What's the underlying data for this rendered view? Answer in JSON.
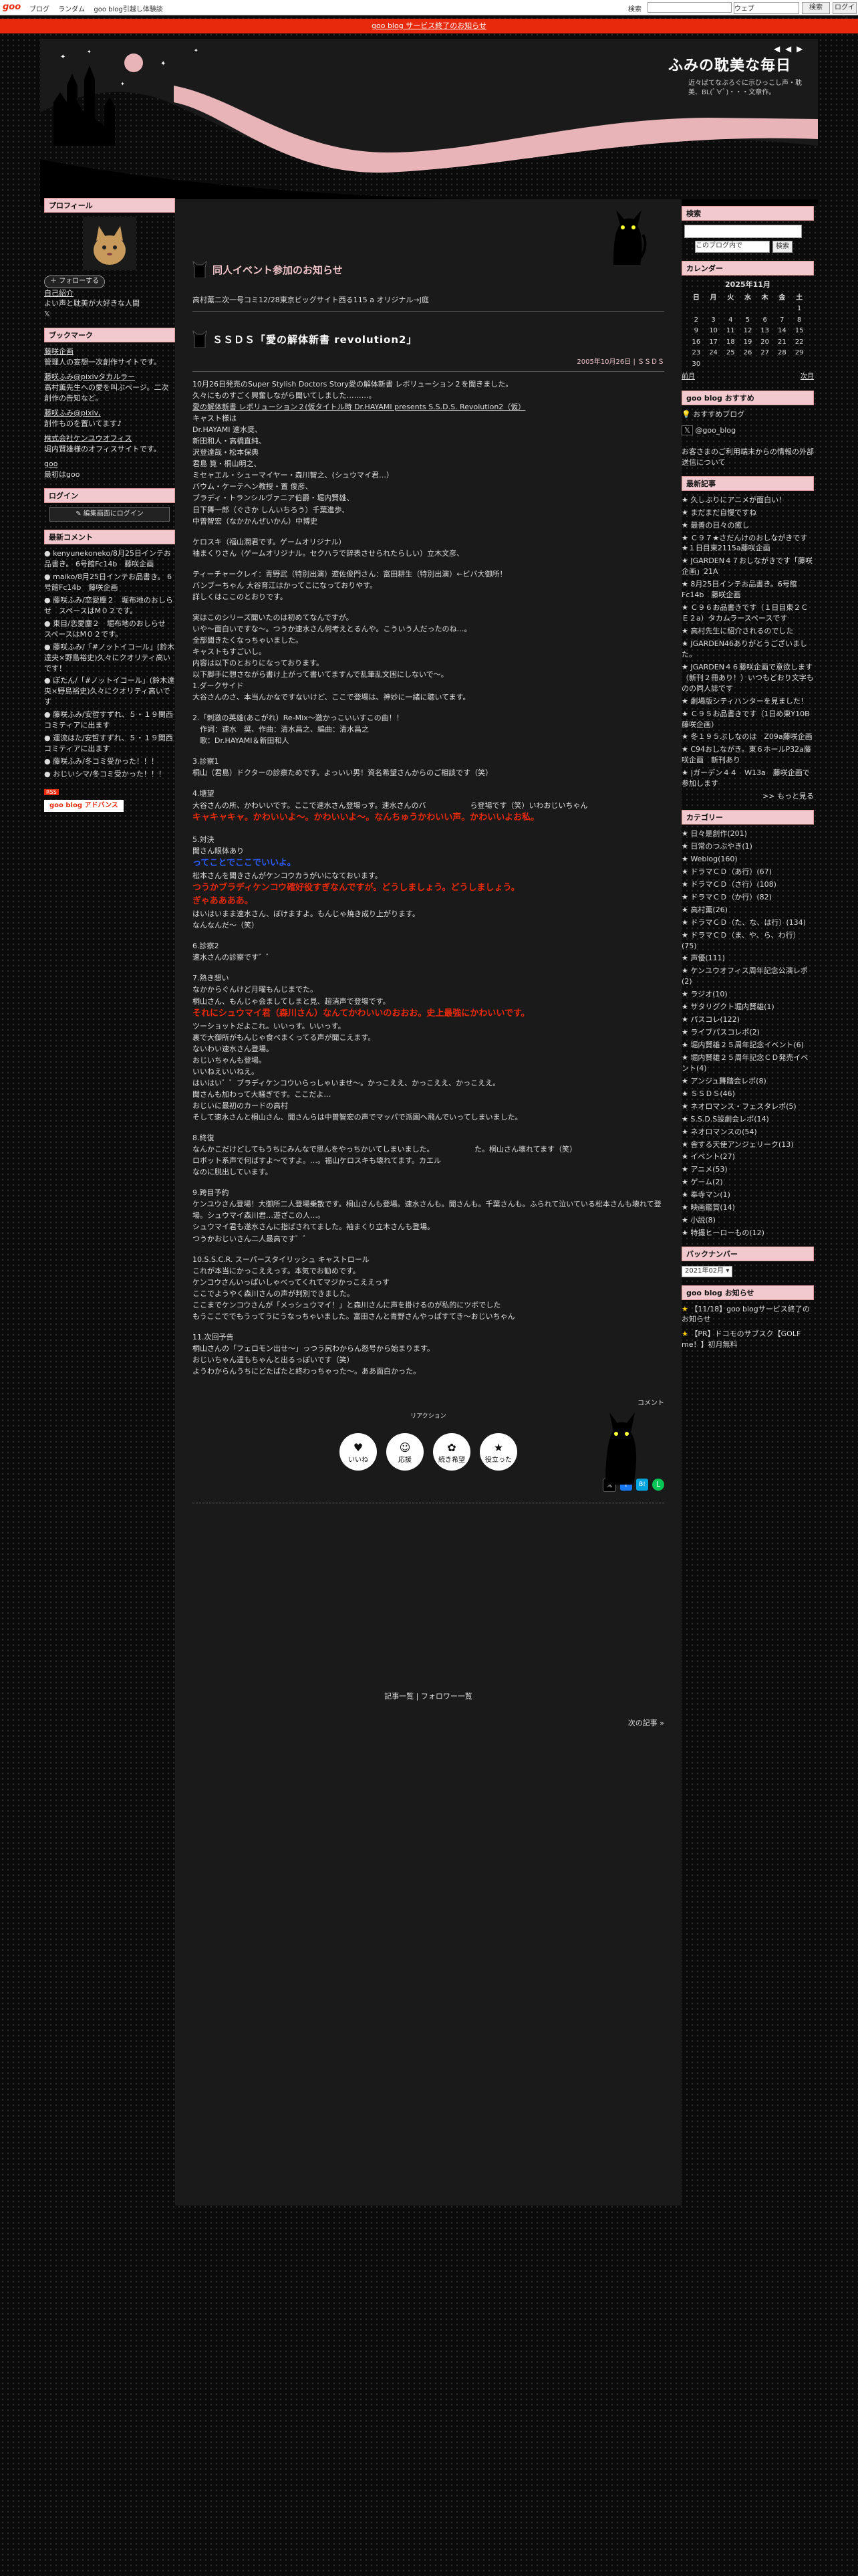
{
  "topbar": {
    "logo": "goo",
    "nav": [
      "ブログ",
      "ランダム",
      "goo blog引越し体験談"
    ],
    "search_label": "検索",
    "search_select": "ウェブ",
    "search_button": "検索",
    "search_button2": "ログイン"
  },
  "notice": {
    "text": "goo blog サービス終了のお知らせ"
  },
  "header": {
    "title": "ふみの耽美な毎日",
    "description": "近々ぱてなぶろぐに示ひっこし声・耽美、BL(ﾟ∀ﾟ)・・・文章作。",
    "nav_icons": "◀ ◀ ▶"
  },
  "left": {
    "profile_title": "プロフィール",
    "follow_button": "フォローする",
    "profile_links": [
      "自己紹介",
      "よい声と耽美が大好きな人間",
      "𝕏"
    ],
    "bookmark_title": "ブックマーク",
    "bookmarks": [
      "藤咲企画",
      "管理人の妄想一次創作サイトです。",
      "藤咲ふみ@pixivタカルラー",
      "高村薫先生への愛を叫ぶページ。二次創作の告知など。",
      "藤咲ふみ@pixiv,",
      "創作ものを置いてます♪",
      "株式会社ケンユウオフィス",
      "堀内賢雄様のオフィスサイトです。",
      "goo",
      "最初はgoo"
    ],
    "login_title": "ログイン",
    "login_button": "編集画面にログイン",
    "comments_title": "最新コメント",
    "comments": [
      "kenyunekoneko/8月25日インテお品書き。 6号館Fc14b　藤咲企画",
      "maiko/8月25日インテお品書き。 6号館Fc14b　藤咲企画",
      "藤咲ふみ/恋愛塵２　堀布地のおしらせ　スペースはM０２です。",
      "東目/恋愛塵２　堀布地のおしらせ　スペースはM０２です。",
      "藤咲ふみ/「#ノットイコール」(鈴木達央×野島裕史)久々にクオリティ高いです！",
      "ぽたん/「#ノットイコール」(鈴木達央×野島裕史)久々にクオリティ高いです",
      "藤咲ふみ/安哲すずれ、５・１９関西コミティアに出ます",
      "運流はた/安哲すずれ、５・１９関西コミティアに出ます",
      "藤咲ふみ/冬コミ受かった！！！",
      "おじいシマ/冬コミ受かった！！！"
    ],
    "rss": "RSS",
    "adv_button": "goo blog アドバンス"
  },
  "right": {
    "search_title": "検索",
    "search_select": "このブログ内で",
    "search_button": "検索",
    "calendar_title": "カレンダー",
    "calendar_month": "2025年11月",
    "weekdays": [
      "日",
      "月",
      "火",
      "水",
      "木",
      "金",
      "土"
    ],
    "weeks": [
      [
        "",
        "",
        "",
        "",
        "",
        "",
        "1"
      ],
      [
        "2",
        "3",
        "4",
        "5",
        "6",
        "7",
        "8"
      ],
      [
        "9",
        "10",
        "11",
        "12",
        "13",
        "14",
        "15"
      ],
      [
        "16",
        "17",
        "18",
        "19",
        "20",
        "21",
        "22"
      ],
      [
        "23",
        "24",
        "25",
        "26",
        "27",
        "28",
        "29"
      ],
      [
        "30",
        "",
        "",
        "",
        "",
        "",
        ""
      ]
    ],
    "cal_prev": "前月",
    "cal_next": "次月",
    "follow_title": "goo blog おすすめ",
    "follow_items": [
      "おすすめブログ",
      "@goo_blog"
    ],
    "follow_note": "お客さまのご利用端末からの情報の外部送信について",
    "recent_title": "最新記事",
    "recent": [
      "久しぶりにアニメが面白い！",
      "まだまだ自慢ですね",
      "最善の日々の癒し",
      "Ｃ９７★さだんけのおしながきです★１日目東2115a藤咲企画",
      "JGARDEN４７おしながきです「藤咲企画」21A",
      "8月25日インテお品書き。6号館Fc14b　藤咲企画",
      "Ｃ９６お品書きです（１日目東２ＣＥ２a）タカムラースペースです",
      "高村先生に紹介されるのでした",
      "JGARDEN46ありがとうございました。",
      "JGARDEN４６藤咲企画で意欲します（新刊２冊あり！）いつもどおり文字ものの同人誌です",
      "劇場版シティハンターを見ました！",
      "Ｃ９５お品書きです（1日め東Y10B藤咲企画）",
      "冬１９５ぶしなのは　Z09a藤咲企画",
      "C94おしながき。東６ホールP32a藤咲企画　新刊あり",
      "|ガーデン４４　Ｗ13a　藤咲企画で参加します"
    ],
    "recent_more": ">> もっと見る",
    "category_title": "カテゴリー",
    "categories": [
      "日々是創作(201)",
      "日常のつぶやき(1)",
      "Weblog(160)",
      "ドラマＣＤ（あ行）(67)",
      "ドラマＣＤ（さ行）(108)",
      "ドラマＣＤ（か行）(82)",
      "高村薫(26)",
      "ドラマＣＤ（た、な、は行）(134)",
      "ドラマＣＤ（ま、や、ら、わ行）(75)",
      "声優(111)",
      "ケンユウオフィス周年記念公演レポ(2)",
      "ラジオ(10)",
      "サタリグクト堀内賢雄(1)",
      "パスコレ(122)",
      "ライブパスコレポ(2)",
      "堀内賢雄２５周年記念イベント(6)",
      "堀内賢雄２５周年記念ＣＤ発売イベント(4)",
      "アンジュ舞踏会レポ(8)",
      "ＳＳＤＳ(46)",
      "ネオロマンス・フェスタレポ(5)",
      "S.S.D.S設劇会レポ(14)",
      "ネオロマンスの(54)",
      "舎する天使アンジェリーク(13)",
      "イベント(27)",
      "アニメ(53)",
      "ゲーム(2)",
      "奉寺マン(1)",
      "映画鑑賞(14)",
      "小説(8)",
      "特撮ヒーローもの(12)"
    ],
    "backnumber_title": "バックナンバー",
    "backnumber_select": "2021年02月",
    "news_title": "goo blog お知らせ",
    "news": [
      "【11/18】goo blogサービス終了のお知らせ",
      "【PR】ドコモのサブスク【GOLF me！】初月無料"
    ]
  },
  "post1": {
    "title": "同人イベント参加のお知らせ",
    "text": "高村薫二次一号コミ12/28東京ビッグサイト西る115 a オリジナル→J庭"
  },
  "post2": {
    "title": "ＳＳＤＳ「愛の解体新書 revolution2」",
    "date": "2005年10月26日 | ＳＳＤＳ",
    "paragraphs": [
      "10月26日発売のSuper Stylish Doctors Story愛の解体新書 レボリューション２を聞きました。",
      "久々にものすごく興奮しながら聞いてしました………。",
      "愛の解体新書 レボリューション２(仮タイトル時 Dr.HAYAMI presents S.S.D.S. Revolution2（仮）",
      "キャスト様は",
      "Dr.HAYAMI 速水奨、",
      "新田和人・高橋直純、",
      "沢登達哉・松本保典",
      "君島 筧・桐山明之、",
      "ミセャエル・シューマイヤー・森川智之、(シュウマイ君…）",
      "バウム・ケーテヘン教授・置 俊彦、",
      "ブラディ・トランシルヴァニア伯爵・堀内賢雄、",
      "日下舞一郎（ぐさか しんいちろう）千葉進歩、",
      "中曽智宏（なかかんぜいかん）中博史",
      "ケロスキ（福山潤君です。ゲームオリジナル）",
      "袖まくりさん（ゲームオリジナル。セクハラで辞表させられたらしい）立木文彦、",
      "ティーチャークレイ：青野武（特別出演）遊佐俊門さん：富田耕生（特別出演）←ビバ大御所！",
      "バンブーちゃん 大谷育江はかってこになっておりやす。",
      "詳しくはここのとおりです。",
      "実はこのシリーズ聞いたのは初めてなんですが。",
      "いや〜面白いですな〜。つうか速水さん何考えとるんや。こういう人だったのね…。",
      "全部聞きたくなっちゃいました。",
      "キャストもすごいし。",
      "内容は以下のとおりになっております。",
      "以下脚手に想さながら書け上がって書いてますんで乱筆乱文困にしないで〜。",
      "1.ダークサイド",
      "大谷さんのさ、本当んかなですないけど、ここで登場は、神妙に一緒に聴いてます。",
      "2.「刺激の英雄(あこがれ）Re-Mix〜激かっこいいすこの曲！！",
      "　作詞：速水　奨、作曲：清水昌之、編曲：清水昌之",
      "　歌：Dr.HAYAMI＆新田和人",
      "3.診察1",
      "桐山（君島）ドクターの診察ためです。よっいい男！資名希望さんからのご相談です（笑）",
      "4.塘望",
      "大谷さんの所、かわいいです。ここで速水さん登場っす。速水さんのバ　　　　　　ら登場です（笑）いわおじいちゃん",
      "キャキャキャ。かわいいよ〜。かわいいよ〜。なんちゅうかわいい声。かわいいよお私。",
      "5.対決",
      "聞さん眼体あり",
      "ってことでここでいいよ。",
      "松本さんを聞きさんがケンコウカうがいになておいます。",
      "つうかブラディケンコウ確好役すぎなんですが。どうしましょう。どうしましょう。",
      "ぎゃああああ。",
      "はいはいまま速水さん、ぼけますよ。もんじゃ焼き成り上がります。",
      "なんなんだ〜（笑）",
      "6.診察2",
      "速水さんの診察です゛゛",
      "7.熱き想い",
      "なかからぐんけど月曜もんじまでた。",
      "桐山さん、もんじゃ会ましてしまと見、超消声で登場です。",
      "それにシュウマイ君（森川さん）なんてかわいいのおおお。史上最強にかわいいです。",
      "ツーショットだよこれ。いいっす。いいっす。",
      "裏で大御所がもんじゃ食べまくってる声が聞こえます。",
      "ないわい速水さん登場。",
      "おじいちゃんも登場。",
      "いいねえいいねえ。",
      "はいはい゛゛ブラディケンコウいらっしゃいませ〜。かっこええ、かっこええ、かっこええ。",
      "聞さんも加わって大騒ぎです。ここだよ…",
      "おじいに最初のカードの高村",
      "そして速水さんと桐山さん、聞さんらは中曽智宏の声でマッパで派園へ飛んでいってしまいました。",
      "8.終復",
      "なんかこだけどしてもうちにみんなで思んをやっちかいてしまいました。　　　　　　た。桐山さん壊れてます（笑）",
      "ロボット系声で何ばすよ〜ですよ。…。福山ケロスキも壊れてます。カエル",
      "なのに脱出しています。",
      "9.跨目予約",
      "ケンユウさん登場！大御所二人登場乗散です。桐山さんも登場。速水さんも。聞さんも。千葉さんも。ふられて泣いている松本さんも壊れて登場。シュウマイ森川君…遊ざこの人…。",
      "シュウマイ君も遂水さんに指ばされてました。袖まくり立木さんも登場。",
      "つうかおじいさん二人最高です゛゛",
      "10.S.S.C.R. スーパースタイリッシュ キャストロール",
      "これが本当にかっこええっす。本気でお勧めです。",
      "ケンコウさんいっぱいしゃべってくれてマジかっこええっす",
      "ここでようやく森川さんの声が判別できました。",
      "ここまでケンコウさんが「メっシュウマイ！」と森川さんに声を掛けるのが私的にツボでした",
      "もうここででもうってうにうなっちゃいました。富田さんと青野さんやっぱすてき〜おじいちゃん",
      "11.次回予告",
      "桐山さんの「フェロモン出せ〜」っつう尻わからん怒号から始まります。",
      "おじいちゃん達もちゃんと出るっぽいです（笑）",
      "ようわからんうちにどたばたと終わっちゃった〜。ああ面白かった。"
    ],
    "reaction_label": "リアクション",
    "reactions": [
      {
        "emo": "♥",
        "label": "いいね"
      },
      {
        "emo": "☺",
        "label": "応援"
      },
      {
        "emo": "✿",
        "label": "続き希望"
      },
      {
        "emo": "★",
        "label": "役立った"
      }
    ],
    "comment_label": "コメント",
    "share_icons": [
      "𝕏",
      "f",
      "B!",
      "L"
    ]
  },
  "footer": {
    "links": "記事一覧 | フォロワー一覧",
    "next": "次の記事 »"
  }
}
